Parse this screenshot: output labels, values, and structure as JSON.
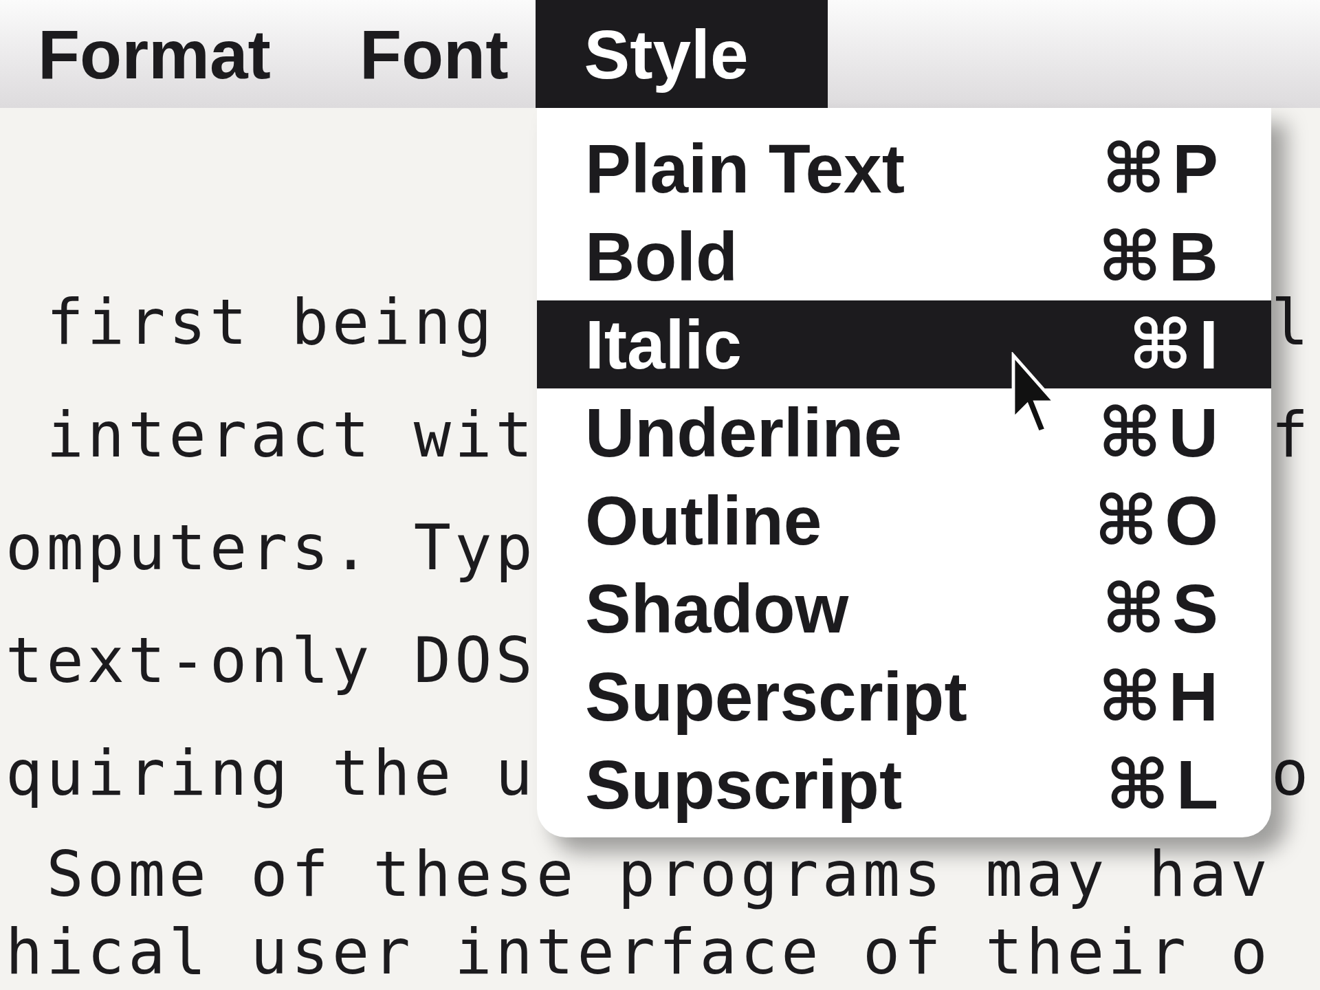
{
  "menu_bar": {
    "items": [
      {
        "label": "Format",
        "selected": false
      },
      {
        "label": "Font",
        "selected": false
      },
      {
        "label": "Style",
        "selected": true
      }
    ]
  },
  "document": {
    "lines": [
      {
        "left": " first being",
        "right": "l"
      },
      {
        "left": " interact wit",
        "right": "f"
      },
      {
        "left": "omputers. Typ"
      },
      {
        "left": "text-only DOS"
      },
      {
        "left": "quiring the u",
        "right": "o"
      },
      {
        "left": " Some of these programs may hav"
      },
      {
        "left": "hical user interface of their o"
      }
    ]
  },
  "menu": {
    "items": [
      {
        "label": "Plain Text",
        "shortcut": "⌘P",
        "selected": false
      },
      {
        "label": "Bold",
        "shortcut": "⌘B",
        "selected": false
      },
      {
        "label": "Italic",
        "shortcut": "⌘I",
        "selected": true
      },
      {
        "label": "Underline",
        "shortcut": "⌘U",
        "selected": false
      },
      {
        "label": "Outline",
        "shortcut": "⌘O",
        "selected": false
      },
      {
        "label": "Shadow",
        "shortcut": "⌘S",
        "selected": false
      },
      {
        "label": "Superscript",
        "shortcut": "⌘H",
        "selected": false
      },
      {
        "label": "Supscript",
        "shortcut": "⌘L",
        "selected": false
      }
    ]
  }
}
